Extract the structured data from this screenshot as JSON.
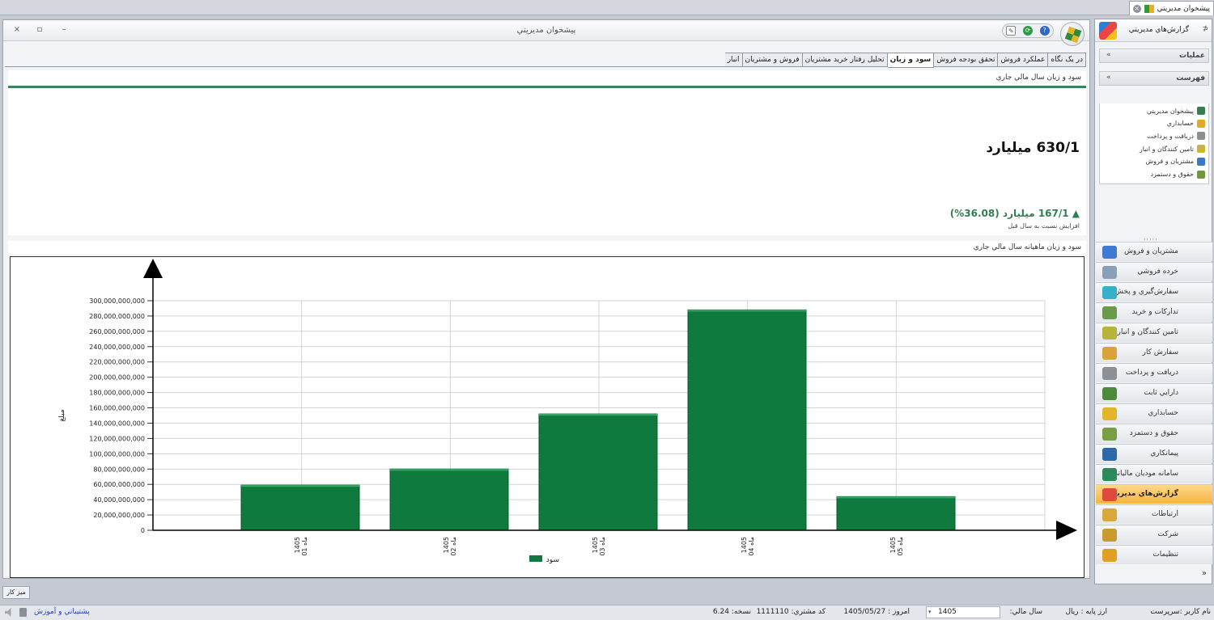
{
  "doc_tab": {
    "label": "پيشخوان مديريتي"
  },
  "window": {
    "title": "پيشخوان مديريتي",
    "close": "×",
    "restore": "▫",
    "minimize": "–"
  },
  "tabs": [
    {
      "label": "در يک نگاه",
      "active": false
    },
    {
      "label": "عملکرد فروش",
      "active": false
    },
    {
      "label": "تحقق بودجه فروش",
      "active": false
    },
    {
      "label": "سود و زيان",
      "active": true
    },
    {
      "label": "تحليل رفتار خريد مشتريان",
      "active": false
    },
    {
      "label": "فروش و مشتريان",
      "active": false
    },
    {
      "label": "انبار",
      "active": false
    }
  ],
  "kpi": {
    "title": "سود و زيان سال مالي جاري",
    "value": "630/1 ميليارد",
    "delta": "▲ 167/1 ميليارد (36.08%)",
    "delta_caption": "افزايش نسبت به سال قبل"
  },
  "chart_title": "سود و زيان ماهيانه سال مالي جاري",
  "chart_data": {
    "type": "bar",
    "categories": [
      "1405 01 ماه",
      "1405 02 ماه",
      "1405 03 ماه",
      "1405 04 ماه",
      "1405 05 ماه"
    ],
    "category_labels": [
      {
        "year": "1405",
        "month": "01 ماه"
      },
      {
        "year": "1405",
        "month": "02 ماه"
      },
      {
        "year": "1405",
        "month": "03 ماه"
      },
      {
        "year": "1405",
        "month": "04 ماه"
      },
      {
        "year": "1405",
        "month": "05 ماه"
      }
    ],
    "series": [
      {
        "name": "سود",
        "values": [
          59000000000,
          80000000000,
          152000000000,
          288000000000,
          44000000000
        ]
      }
    ],
    "ylabel": "مبلغ",
    "ylim": [
      0,
      300000000000
    ],
    "yticks": [
      "0",
      "20,000,000,000",
      "40,000,000,000",
      "60,000,000,000",
      "80,000,000,000",
      "100,000,000,000",
      "120,000,000,000",
      "140,000,000,000",
      "160,000,000,000",
      "180,000,000,000",
      "200,000,000,000",
      "220,000,000,000",
      "240,000,000,000",
      "260,000,000,000",
      "280,000,000,000",
      "300,000,000,000"
    ],
    "grid": true,
    "legend": "bottom-center",
    "color": "#0e7a3e"
  },
  "desk_button": "ميز كار",
  "status": {
    "user": "نام کاربر :سرپرست",
    "base_currency": "ارز پايه : ريال",
    "fiscal_year_label": "سال مالي:",
    "fiscal_year": "1405",
    "dropdown": "▾",
    "today": "امروز : 1405/05/27",
    "customer_code": "کد مشتري: 1111110",
    "version": "نسخه: 6.24",
    "support": "پشتيباني و آموزش"
  },
  "nav": {
    "header": "گزارش‌هاي مديريتي",
    "pin": "⊅",
    "sections": {
      "operations": "عمليات",
      "index": "فهرست",
      "collapse": "«"
    },
    "menu": [
      {
        "label": "پيشخوان مديريتي",
        "color": "#3a7d4d"
      },
      {
        "label": "حسابداري",
        "color": "#e3a72a"
      },
      {
        "label": "دريافت و پرداخت",
        "color": "#8c8f94"
      },
      {
        "label": "تامين کنندگان و انبار",
        "color": "#c9b43c"
      },
      {
        "label": "مشتريان و فروش",
        "color": "#3c77c9"
      },
      {
        "label": "حقوق و دستمزد",
        "color": "#6f9a3a"
      }
    ],
    "dots": "·····",
    "modules": [
      {
        "label": "مشتريان و فروش",
        "color": "#3d7ad1",
        "active": false
      },
      {
        "label": "خرده فروشي",
        "color": "#8aa0b8",
        "active": false
      },
      {
        "label": "سفارش‌گيري و پخش",
        "color": "#38b0c9",
        "active": false
      },
      {
        "label": "تداركات و خريد",
        "color": "#6a9a4a",
        "active": false
      },
      {
        "label": "تامين کنندگان و انبار",
        "color": "#b7b33b",
        "active": false
      },
      {
        "label": "سفارش كار",
        "color": "#d9a33a",
        "active": false
      },
      {
        "label": "دريافت و پرداخت",
        "color": "#8c8f94",
        "active": false
      },
      {
        "label": "دارايي ثابت",
        "color": "#4c8a3c",
        "active": false
      },
      {
        "label": "حسابداري",
        "color": "#e2b52b",
        "active": false
      },
      {
        "label": "حقوق و دستمزد",
        "color": "#78a043",
        "active": false
      },
      {
        "label": "پيمانكاري",
        "color": "#2b69a8",
        "active": false
      },
      {
        "label": "سامانه مودیان مالیاتی",
        "color": "#2a8a5a",
        "active": false
      },
      {
        "label": "گزارش‌هاي مديريتي",
        "color": "#e04a3a",
        "active": true
      },
      {
        "label": "ارتباطات",
        "color": "#d8a83a",
        "active": false
      },
      {
        "label": "شركت",
        "color": "#c99a2e",
        "active": false
      },
      {
        "label": "تنظيمات",
        "color": "#e0a020",
        "active": false
      }
    ],
    "more": "»"
  }
}
